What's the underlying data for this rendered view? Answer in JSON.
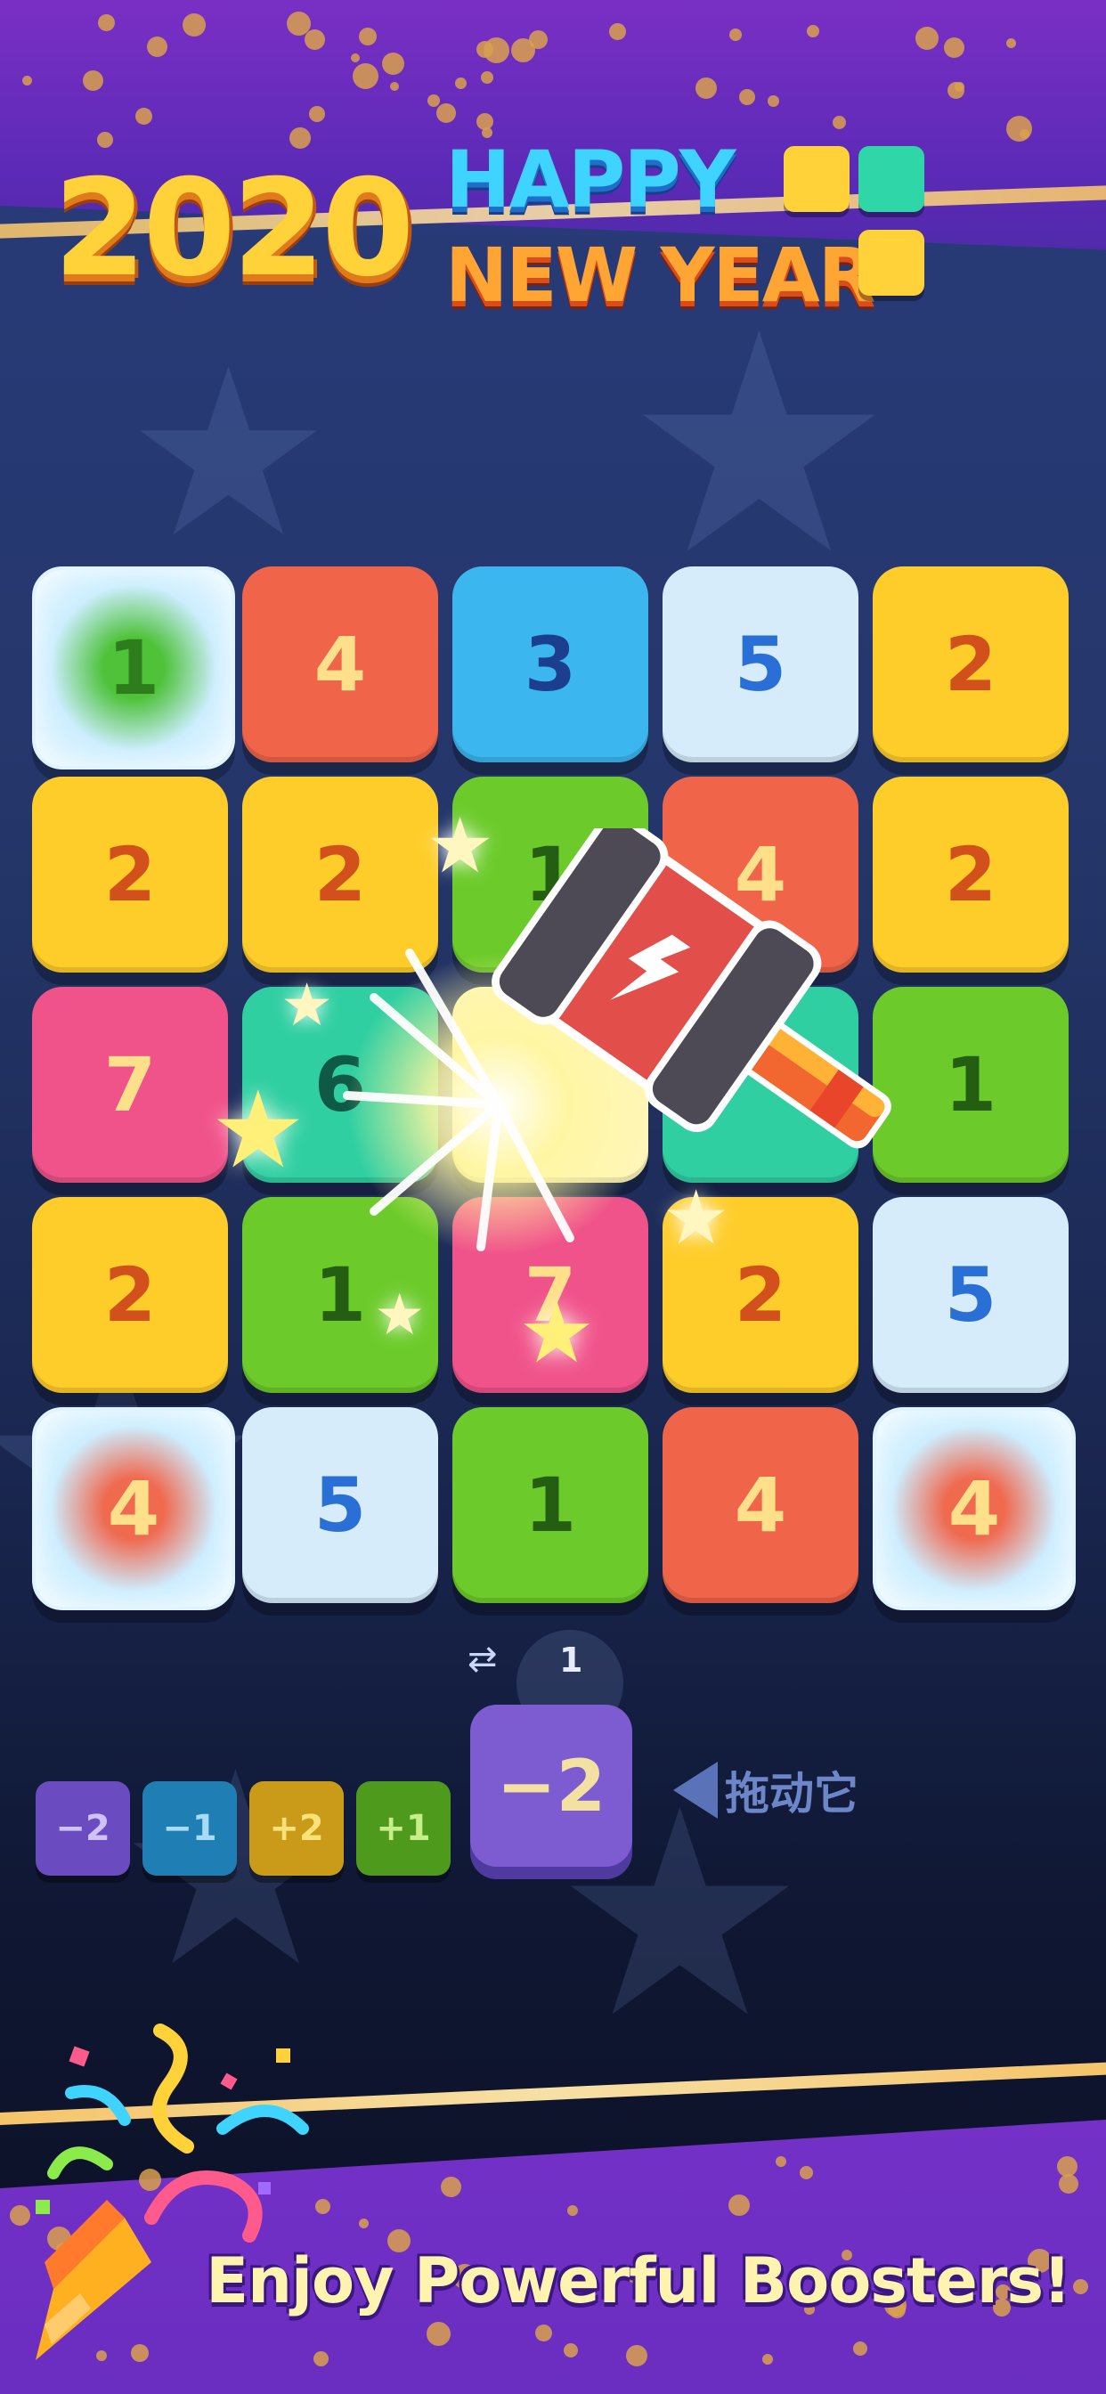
{
  "logo": {
    "year": "2020",
    "line1": "HAPPY",
    "line2": "NEW YEAR",
    "square_colors": [
      "#ffd23a",
      "#2fd6a8",
      "#ffd23a"
    ]
  },
  "board": {
    "rows": [
      [
        {
          "value": "1",
          "color": "#4fc23a",
          "frozen": true,
          "text": "#2e7d1c"
        },
        {
          "value": "4",
          "color": "#f0644a",
          "frozen": false,
          "text": "#ffe08a"
        },
        {
          "value": "3",
          "color": "#3cb6ee",
          "frozen": false,
          "text": "#1b3f8e"
        },
        {
          "value": "5",
          "color": "#d6ecfb",
          "frozen": false,
          "text": "#2a6fd6"
        },
        {
          "value": "2",
          "color": "#ffcd2a",
          "frozen": false,
          "text": "#d2501c"
        }
      ],
      [
        {
          "value": "2",
          "color": "#ffcd2a",
          "frozen": false,
          "text": "#d2501c"
        },
        {
          "value": "2",
          "color": "#ffcd2a",
          "frozen": false,
          "text": "#d2501c"
        },
        {
          "value": "1",
          "color": "#6ccb2a",
          "frozen": false,
          "text": "#245e12"
        },
        {
          "value": "4",
          "color": "#f0644a",
          "frozen": false,
          "text": "#ffe08a"
        },
        {
          "value": "2",
          "color": "#ffcd2a",
          "frozen": false,
          "text": "#d2501c"
        }
      ],
      [
        {
          "value": "7",
          "color": "#f0528a",
          "frozen": false,
          "text": "#ffe08a"
        },
        {
          "value": "6",
          "color": "#2fcfa2",
          "frozen": false,
          "text": "#0f5a46"
        },
        {
          "value": "",
          "color": "#fff6b8",
          "frozen": false,
          "text": "#fff"
        },
        {
          "value": "",
          "color": "#2fcfa2",
          "frozen": false,
          "text": "#0f5a46"
        },
        {
          "value": "1",
          "color": "#6ccb2a",
          "frozen": false,
          "text": "#245e12"
        }
      ],
      [
        {
          "value": "2",
          "color": "#ffcd2a",
          "frozen": false,
          "text": "#d2501c"
        },
        {
          "value": "1",
          "color": "#6ccb2a",
          "frozen": false,
          "text": "#245e12"
        },
        {
          "value": "7",
          "color": "#f0528a",
          "frozen": false,
          "text": "#ffe08a"
        },
        {
          "value": "2",
          "color": "#ffcd2a",
          "frozen": false,
          "text": "#d2501c"
        },
        {
          "value": "5",
          "color": "#d6ecfb",
          "frozen": false,
          "text": "#2a6fd6"
        }
      ],
      [
        {
          "value": "4",
          "color": "#f06a50",
          "frozen": true,
          "text": "#ffe08a"
        },
        {
          "value": "5",
          "color": "#d6ecfb",
          "frozen": false,
          "text": "#2a6fd6"
        },
        {
          "value": "1",
          "color": "#6ccb2a",
          "frozen": false,
          "text": "#245e12"
        },
        {
          "value": "4",
          "color": "#f0644a",
          "frozen": false,
          "text": "#ffe08a"
        },
        {
          "value": "4",
          "color": "#f06a50",
          "frozen": true,
          "text": "#ffe08a"
        }
      ]
    ]
  },
  "swap": {
    "icon": "swap-arrows-icon",
    "count": "1"
  },
  "boosters": [
    {
      "label": "−2",
      "color": "#6a4cc0",
      "text": "#cfc2f4"
    },
    {
      "label": "−1",
      "color": "#1f7fb4",
      "text": "#a8dcf6"
    },
    {
      "label": "+2",
      "color": "#c99b18",
      "text": "#f9e27a"
    },
    {
      "label": "+1",
      "color": "#4e9a1c",
      "text": "#c6ef88"
    }
  ],
  "active_booster": {
    "label": "−2"
  },
  "drag_hint": "拖动它",
  "slogan": "Enjoy Powerful Boosters!"
}
